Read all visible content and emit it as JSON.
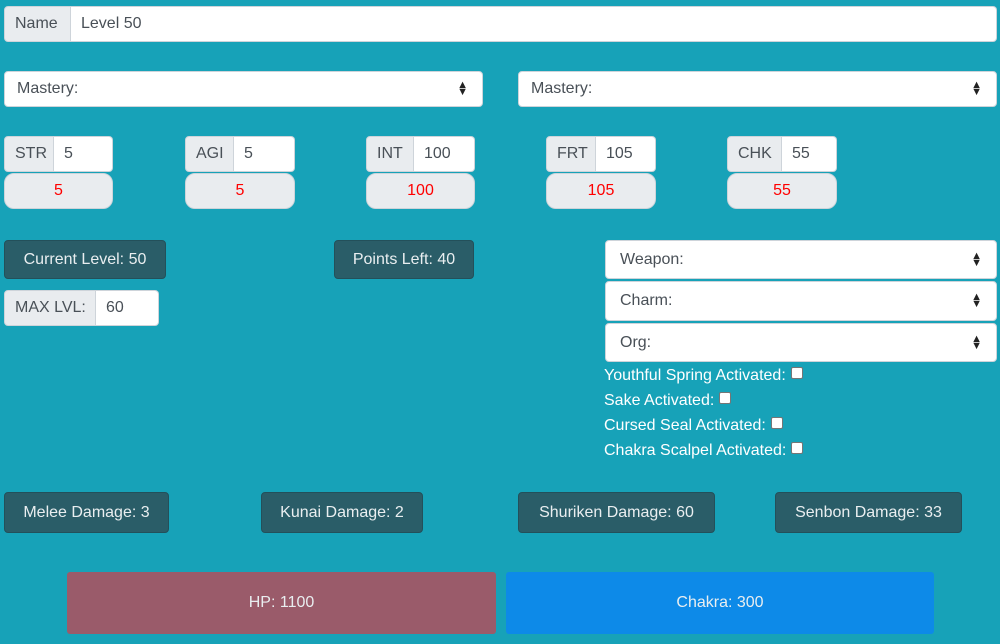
{
  "name": {
    "label": "Name",
    "value": "Level 50"
  },
  "mastery": {
    "left": "Mastery:",
    "right": "Mastery:"
  },
  "stats": [
    {
      "label": "STR",
      "value": "5",
      "computed": "5"
    },
    {
      "label": "AGI",
      "value": "5",
      "computed": "5"
    },
    {
      "label": "INT",
      "value": "100",
      "computed": "100"
    },
    {
      "label": "FRT",
      "value": "105",
      "computed": "105"
    },
    {
      "label": "CHK",
      "value": "55",
      "computed": "55"
    }
  ],
  "level": {
    "current": "Current Level: 50",
    "points_left": "Points Left: 40",
    "max_label": "MAX LVL:",
    "max_value": "60"
  },
  "equipment": {
    "weapon": "Weapon:",
    "charm": "Charm:",
    "org": "Org:"
  },
  "toggles": [
    "Youthful Spring Activated:",
    "Sake Activated:",
    "Cursed Seal Activated:",
    "Chakra Scalpel Activated:"
  ],
  "damage": {
    "melee": "Melee Damage: 3",
    "kunai": "Kunai Damage: 2",
    "shuriken": "Shuriken Damage: 60",
    "senbon": "Senbon Damage: 33"
  },
  "bars": {
    "hp": "HP: 1100",
    "chakra": "Chakra: 300"
  },
  "colors": {
    "background": "#17a2b8",
    "hp": "#9a5b6a",
    "chakra": "#0d8ae8",
    "computed_text": "#ff0000"
  }
}
